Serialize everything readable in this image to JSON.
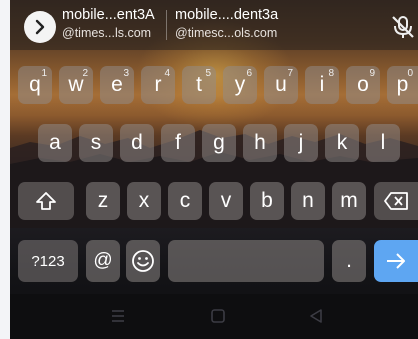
{
  "suggestions": [
    {
      "title": "mobile...ent3A",
      "subtitle": "@times...ls.com"
    },
    {
      "title": "mobile....dent3a",
      "subtitle": "@timesc...ols.com"
    }
  ],
  "icons": {
    "expand": "chevron-right-icon",
    "mic": "mic-off-icon",
    "shift": "shift-arrow-icon",
    "backspace": "backspace-icon",
    "emoji": "smiley-icon",
    "enter": "arrow-right-icon",
    "nav_recent": "menu-lines-icon",
    "nav_home": "square-icon",
    "nav_back": "triangle-back-icon"
  },
  "rows": {
    "row1": [
      {
        "label": "q",
        "hint": "1"
      },
      {
        "label": "w",
        "hint": "2"
      },
      {
        "label": "e",
        "hint": "3"
      },
      {
        "label": "r",
        "hint": "4"
      },
      {
        "label": "t",
        "hint": "5"
      },
      {
        "label": "y",
        "hint": "6"
      },
      {
        "label": "u",
        "hint": "7"
      },
      {
        "label": "i",
        "hint": "8"
      },
      {
        "label": "o",
        "hint": "9"
      },
      {
        "label": "p",
        "hint": "0"
      }
    ],
    "row2": [
      "a",
      "s",
      "d",
      "f",
      "g",
      "h",
      "j",
      "k",
      "l"
    ],
    "row3": [
      "z",
      "x",
      "c",
      "v",
      "b",
      "n",
      "m"
    ]
  },
  "bottom": {
    "symbols": "?123",
    "at": "@",
    "period": "."
  },
  "colors": {
    "enter_key": "#5ea6f2",
    "key_bg": "#928c8b"
  }
}
